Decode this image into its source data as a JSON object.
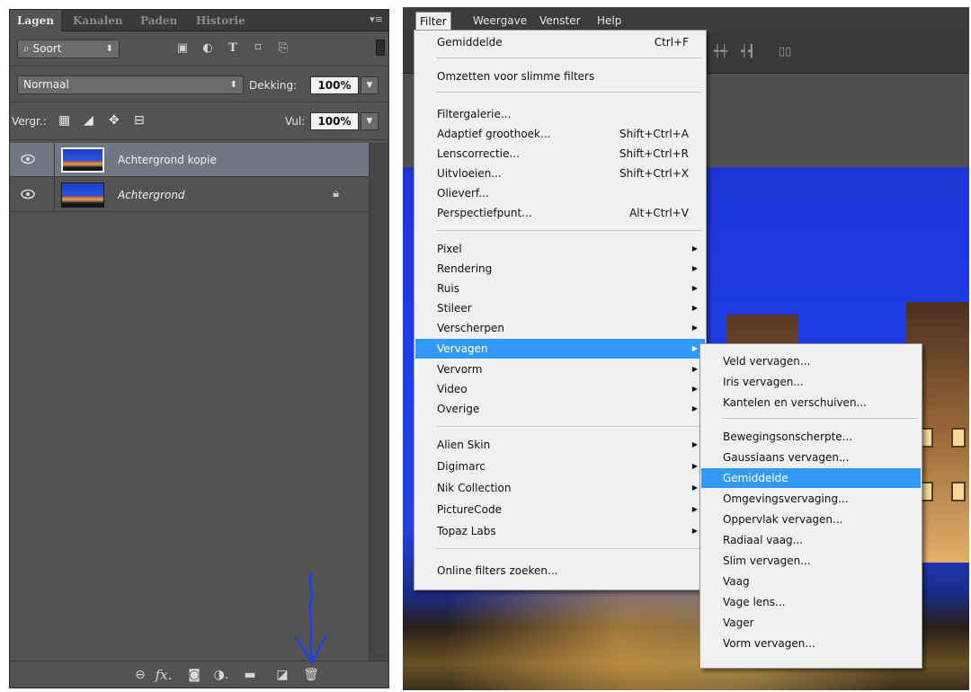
{
  "layers_panel": {
    "tabs": [
      "Lagen",
      "Kanalen",
      "Paden",
      "Historie"
    ],
    "filter_kind": "Soort",
    "blend_mode": "Normaal",
    "opacity_label": "Dekking:",
    "opacity_value": "100%",
    "lock_label": "Vergr.:",
    "fill_label": "Vul:",
    "fill_value": "100%",
    "layers": [
      {
        "name": "Achtergrond kopie",
        "selected": true,
        "locked": false
      },
      {
        "name": "Achtergrond",
        "selected": false,
        "locked": true
      }
    ],
    "bottom_icons": [
      "link-icon",
      "fx-icon",
      "mask-icon",
      "adjustment-icon",
      "folder-icon",
      "new-layer-icon",
      "trash-icon"
    ],
    "fx_text": "fx",
    "annotation_arrow_color": "#1a3cff"
  },
  "menubar": {
    "items": [
      "Filter",
      "Weergave",
      "Venster",
      "Help"
    ]
  },
  "filter_menu": {
    "top_items": [
      {
        "label": "Gemiddelde",
        "shortcut": "Ctrl+F"
      }
    ],
    "group1": [
      {
        "label": "Omzetten voor slimme filters"
      }
    ],
    "group2": [
      {
        "label": "Filtergalerie...",
        "shortcut": ""
      },
      {
        "label": "Adaptief groothoek...",
        "shortcut": "Shift+Ctrl+A"
      },
      {
        "label": "Lenscorrectie...",
        "shortcut": "Shift+Ctrl+R"
      },
      {
        "label": "Uitvloeien...",
        "shortcut": "Shift+Ctrl+X"
      },
      {
        "label": "Olieverf...",
        "shortcut": ""
      },
      {
        "label": "Perspectiefpunt...",
        "shortcut": "Alt+Ctrl+V"
      }
    ],
    "group3": [
      "Pixel",
      "Rendering",
      "Ruis",
      "Stileer",
      "Verscherpen",
      "Vervagen",
      "Vervorm",
      "Video",
      "Overige"
    ],
    "group4": [
      "Alien Skin",
      "Digimarc",
      "Nik Collection",
      "PictureCode",
      "Topaz Labs"
    ],
    "group5": [
      "Online filters zoeken..."
    ],
    "highlighted": "Vervagen"
  },
  "blur_submenu": {
    "group1": [
      "Veld vervagen...",
      "Iris vervagen...",
      "Kantelen en verschuiven..."
    ],
    "group2": [
      "Bewegingsonscherpte...",
      "Gaussiaans vervagen...",
      "Gemiddelde",
      "Omgevingsvervaging...",
      "Oppervlak vervagen...",
      "Radiaal vaag...",
      "Slim vervagen...",
      "Vaag",
      "Vage lens...",
      "Vager",
      "Vorm vervagen..."
    ],
    "highlighted": "Gemiddelde"
  },
  "colors": {
    "menu_highlight": "#3399ff",
    "panel_bg": "#535353",
    "canvas_sky": "#1f3fe6"
  }
}
